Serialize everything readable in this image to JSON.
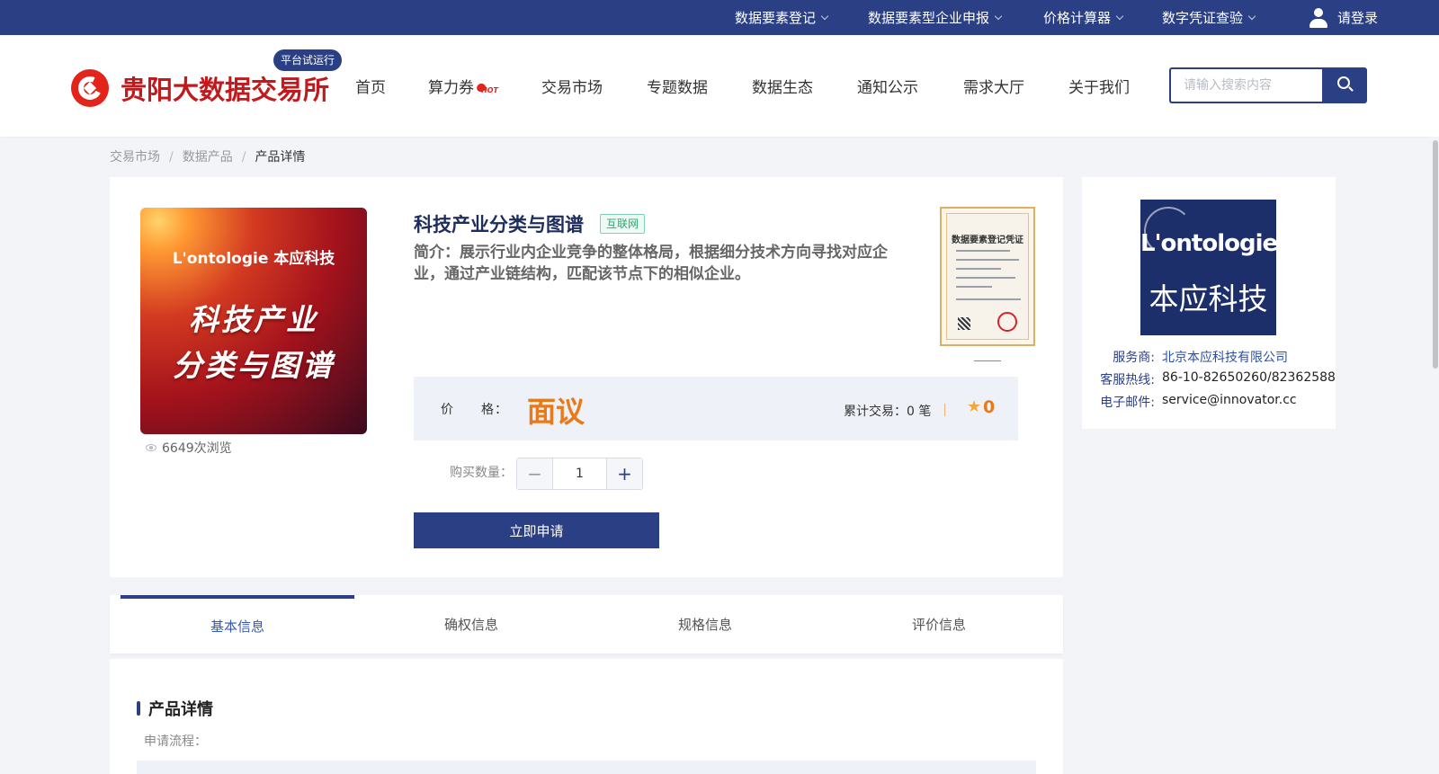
{
  "topbar": {
    "nav": [
      {
        "label": "数据要素登记",
        "icon": "chevron-down-icon"
      },
      {
        "label": "数据要素型企业申报",
        "icon": "chevron-down-icon"
      },
      {
        "label": "价格计算器",
        "icon": "chevron-down-icon"
      },
      {
        "label": "数字凭证查验",
        "icon": "chevron-down-icon"
      }
    ],
    "login_label": "请登录",
    "login_icon": "user-icon"
  },
  "header": {
    "logo_text": "贵阳大数据交易所",
    "trial_badge": "平台试运行",
    "nav": [
      "首页",
      "算力券",
      "交易市场",
      "专题数据",
      "数据生态",
      "通知公示",
      "需求大厅",
      "关于我们"
    ],
    "hot_badge": "HOT",
    "search_placeholder": "请输入搜索内容"
  },
  "breadcrumb": [
    "交易市场",
    "数据产品",
    "产品详情"
  ],
  "product": {
    "image_brand": "L'ontologie 本应科技",
    "image_line1": "科技产业",
    "image_line2": "分类与图谱",
    "views": "6649次浏览",
    "title": "科技产业分类与图谱",
    "tag": "互联网",
    "description": "简介：展示行业内企业竞争的整体格局，根据细分技术方向寻找对应企业，通过产业链结构，匹配该节点下的相似企业。",
    "certificate_title": "数据要素登记凭证",
    "price_label": "价　　格：",
    "price_value": "面议",
    "trades": "累计交易：0 笔",
    "rating": "0",
    "qty_label": "购买数量：",
    "qty_value": "1",
    "apply_label": "立即申请"
  },
  "provider": {
    "logo_line1": "L'ontologie",
    "logo_line2": "本应科技",
    "rows": [
      {
        "key": "服务商:",
        "value": "北京本应科技有限公司"
      },
      {
        "key": "客服热线:",
        "value": "86-10-82650260/82362588"
      },
      {
        "key": "电子邮件:",
        "value": "service@innovator.cc"
      }
    ]
  },
  "tabs": [
    "基本信息",
    "确权信息",
    "规格信息",
    "评价信息"
  ],
  "detail": {
    "section_title": "产品详情",
    "flow_label": "申请流程："
  },
  "colors": {
    "primary": "#2b3f84",
    "brand_red": "#c2191d",
    "price_orange": "#e87a1a",
    "tag_green": "#2ba870"
  }
}
